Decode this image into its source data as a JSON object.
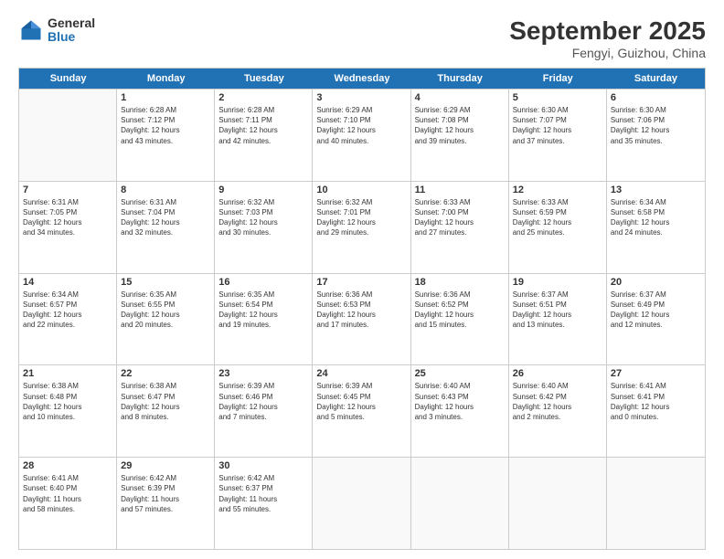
{
  "logo": {
    "general": "General",
    "blue": "Blue"
  },
  "header": {
    "month": "September 2025",
    "location": "Fengyi, Guizhou, China"
  },
  "days": [
    "Sunday",
    "Monday",
    "Tuesday",
    "Wednesday",
    "Thursday",
    "Friday",
    "Saturday"
  ],
  "weeks": [
    [
      {
        "day": "",
        "lines": []
      },
      {
        "day": "1",
        "lines": [
          "Sunrise: 6:28 AM",
          "Sunset: 7:12 PM",
          "Daylight: 12 hours",
          "and 43 minutes."
        ]
      },
      {
        "day": "2",
        "lines": [
          "Sunrise: 6:28 AM",
          "Sunset: 7:11 PM",
          "Daylight: 12 hours",
          "and 42 minutes."
        ]
      },
      {
        "day": "3",
        "lines": [
          "Sunrise: 6:29 AM",
          "Sunset: 7:10 PM",
          "Daylight: 12 hours",
          "and 40 minutes."
        ]
      },
      {
        "day": "4",
        "lines": [
          "Sunrise: 6:29 AM",
          "Sunset: 7:08 PM",
          "Daylight: 12 hours",
          "and 39 minutes."
        ]
      },
      {
        "day": "5",
        "lines": [
          "Sunrise: 6:30 AM",
          "Sunset: 7:07 PM",
          "Daylight: 12 hours",
          "and 37 minutes."
        ]
      },
      {
        "day": "6",
        "lines": [
          "Sunrise: 6:30 AM",
          "Sunset: 7:06 PM",
          "Daylight: 12 hours",
          "and 35 minutes."
        ]
      }
    ],
    [
      {
        "day": "7",
        "lines": [
          "Sunrise: 6:31 AM",
          "Sunset: 7:05 PM",
          "Daylight: 12 hours",
          "and 34 minutes."
        ]
      },
      {
        "day": "8",
        "lines": [
          "Sunrise: 6:31 AM",
          "Sunset: 7:04 PM",
          "Daylight: 12 hours",
          "and 32 minutes."
        ]
      },
      {
        "day": "9",
        "lines": [
          "Sunrise: 6:32 AM",
          "Sunset: 7:03 PM",
          "Daylight: 12 hours",
          "and 30 minutes."
        ]
      },
      {
        "day": "10",
        "lines": [
          "Sunrise: 6:32 AM",
          "Sunset: 7:01 PM",
          "Daylight: 12 hours",
          "and 29 minutes."
        ]
      },
      {
        "day": "11",
        "lines": [
          "Sunrise: 6:33 AM",
          "Sunset: 7:00 PM",
          "Daylight: 12 hours",
          "and 27 minutes."
        ]
      },
      {
        "day": "12",
        "lines": [
          "Sunrise: 6:33 AM",
          "Sunset: 6:59 PM",
          "Daylight: 12 hours",
          "and 25 minutes."
        ]
      },
      {
        "day": "13",
        "lines": [
          "Sunrise: 6:34 AM",
          "Sunset: 6:58 PM",
          "Daylight: 12 hours",
          "and 24 minutes."
        ]
      }
    ],
    [
      {
        "day": "14",
        "lines": [
          "Sunrise: 6:34 AM",
          "Sunset: 6:57 PM",
          "Daylight: 12 hours",
          "and 22 minutes."
        ]
      },
      {
        "day": "15",
        "lines": [
          "Sunrise: 6:35 AM",
          "Sunset: 6:55 PM",
          "Daylight: 12 hours",
          "and 20 minutes."
        ]
      },
      {
        "day": "16",
        "lines": [
          "Sunrise: 6:35 AM",
          "Sunset: 6:54 PM",
          "Daylight: 12 hours",
          "and 19 minutes."
        ]
      },
      {
        "day": "17",
        "lines": [
          "Sunrise: 6:36 AM",
          "Sunset: 6:53 PM",
          "Daylight: 12 hours",
          "and 17 minutes."
        ]
      },
      {
        "day": "18",
        "lines": [
          "Sunrise: 6:36 AM",
          "Sunset: 6:52 PM",
          "Daylight: 12 hours",
          "and 15 minutes."
        ]
      },
      {
        "day": "19",
        "lines": [
          "Sunrise: 6:37 AM",
          "Sunset: 6:51 PM",
          "Daylight: 12 hours",
          "and 13 minutes."
        ]
      },
      {
        "day": "20",
        "lines": [
          "Sunrise: 6:37 AM",
          "Sunset: 6:49 PM",
          "Daylight: 12 hours",
          "and 12 minutes."
        ]
      }
    ],
    [
      {
        "day": "21",
        "lines": [
          "Sunrise: 6:38 AM",
          "Sunset: 6:48 PM",
          "Daylight: 12 hours",
          "and 10 minutes."
        ]
      },
      {
        "day": "22",
        "lines": [
          "Sunrise: 6:38 AM",
          "Sunset: 6:47 PM",
          "Daylight: 12 hours",
          "and 8 minutes."
        ]
      },
      {
        "day": "23",
        "lines": [
          "Sunrise: 6:39 AM",
          "Sunset: 6:46 PM",
          "Daylight: 12 hours",
          "and 7 minutes."
        ]
      },
      {
        "day": "24",
        "lines": [
          "Sunrise: 6:39 AM",
          "Sunset: 6:45 PM",
          "Daylight: 12 hours",
          "and 5 minutes."
        ]
      },
      {
        "day": "25",
        "lines": [
          "Sunrise: 6:40 AM",
          "Sunset: 6:43 PM",
          "Daylight: 12 hours",
          "and 3 minutes."
        ]
      },
      {
        "day": "26",
        "lines": [
          "Sunrise: 6:40 AM",
          "Sunset: 6:42 PM",
          "Daylight: 12 hours",
          "and 2 minutes."
        ]
      },
      {
        "day": "27",
        "lines": [
          "Sunrise: 6:41 AM",
          "Sunset: 6:41 PM",
          "Daylight: 12 hours",
          "and 0 minutes."
        ]
      }
    ],
    [
      {
        "day": "28",
        "lines": [
          "Sunrise: 6:41 AM",
          "Sunset: 6:40 PM",
          "Daylight: 11 hours",
          "and 58 minutes."
        ]
      },
      {
        "day": "29",
        "lines": [
          "Sunrise: 6:42 AM",
          "Sunset: 6:39 PM",
          "Daylight: 11 hours",
          "and 57 minutes."
        ]
      },
      {
        "day": "30",
        "lines": [
          "Sunrise: 6:42 AM",
          "Sunset: 6:37 PM",
          "Daylight: 11 hours",
          "and 55 minutes."
        ]
      },
      {
        "day": "",
        "lines": []
      },
      {
        "day": "",
        "lines": []
      },
      {
        "day": "",
        "lines": []
      },
      {
        "day": "",
        "lines": []
      }
    ]
  ]
}
